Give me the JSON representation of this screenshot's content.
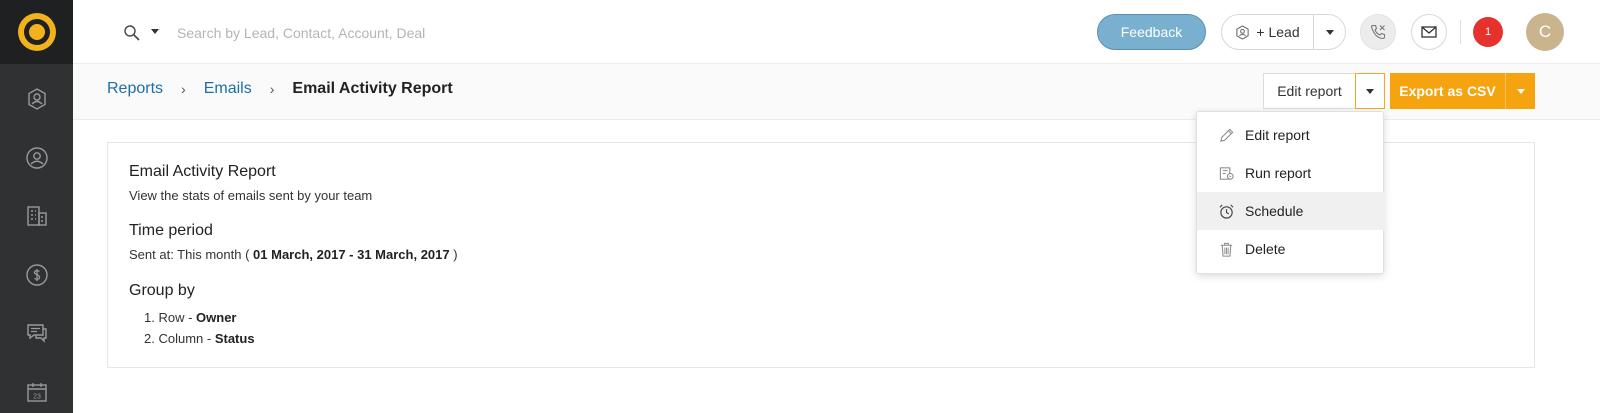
{
  "sidebar": {
    "logo": "logo-icon",
    "items": [
      {
        "name": "leads",
        "icon": "lead-badge-icon"
      },
      {
        "name": "contacts",
        "icon": "contact-icon"
      },
      {
        "name": "accounts",
        "icon": "building-icon"
      },
      {
        "name": "deals",
        "icon": "dollar-icon"
      },
      {
        "name": "messages",
        "icon": "chat-icon"
      },
      {
        "name": "calendar",
        "icon": "calendar-icon",
        "day": "23"
      }
    ]
  },
  "topbar": {
    "search_placeholder": "Search by Lead, Contact, Account, Deal",
    "feedback_label": "Feedback",
    "lead_label": "+ Lead",
    "notification_count": "1",
    "avatar_initial": "C"
  },
  "breadcrumb": {
    "items": [
      "Reports",
      "Emails"
    ],
    "separator": "›",
    "current": "Email Activity Report"
  },
  "actions": {
    "edit_label": "Edit report",
    "export_label": "Export as CSV"
  },
  "dropdown": {
    "items": [
      {
        "label": "Edit report",
        "icon": "pencil-icon"
      },
      {
        "label": "Run report",
        "icon": "run-report-icon"
      },
      {
        "label": "Schedule",
        "icon": "alarm-clock-icon",
        "highlighted": true
      },
      {
        "label": "Delete",
        "icon": "trash-icon"
      }
    ]
  },
  "report": {
    "title": "Email Activity Report",
    "description": "View the stats of emails sent by your team",
    "time_period_title": "Time period",
    "sent_prefix": "Sent at: This month ( ",
    "sent_range": "01 March, 2017 - 31 March, 2017",
    "sent_suffix": " )",
    "group_by_title": "Group by",
    "group_by": [
      {
        "num": "1.",
        "label": "Row - ",
        "value": "Owner"
      },
      {
        "num": "2.",
        "label": "Column - ",
        "value": "Status"
      }
    ]
  },
  "colors": {
    "sidebar": "#2f3133",
    "accent_orange": "#f5a30f",
    "feedback_blue": "#7ab0cf",
    "link_blue": "#1d6fa5",
    "badge_red": "#e5322d"
  }
}
